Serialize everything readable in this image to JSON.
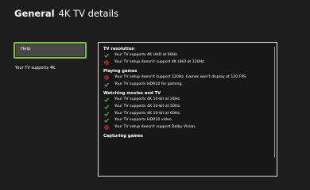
{
  "header": {
    "section": "General",
    "page": "4K TV details"
  },
  "sidebar": {
    "help_label": "Help",
    "tv_support_text": "Your TV supports 4K."
  },
  "colors": {
    "accent": "#7ec33a",
    "ok": "#5fc24a",
    "error": "#e0263b"
  },
  "details": {
    "sections": [
      {
        "title": "TV resolution",
        "rows": [
          {
            "status": "ok",
            "icon": "check-icon",
            "text": "Your TV supports 4K UHD at 60Hz."
          },
          {
            "status": "error",
            "icon": "prohibited-icon",
            "text": "Your TV setup doesn't support 4K UHD at 120Hz."
          }
        ]
      },
      {
        "title": "Playing games",
        "rows": [
          {
            "status": "error",
            "icon": "prohibited-icon",
            "text": "Your TV setup doesn't support 120Hz. Games won't display at 120 FPS."
          },
          {
            "status": "ok",
            "icon": "check-icon",
            "text": "Your TV supports HDR10 for gaming."
          }
        ]
      },
      {
        "title": "Watching movies and TV",
        "rows": [
          {
            "status": "ok",
            "icon": "check-icon",
            "text": "Your TV supports 4K 10-bit at 24Hz."
          },
          {
            "status": "ok",
            "icon": "check-icon",
            "text": "Your TV supports 4K 10-bit at 50Hz."
          },
          {
            "status": "ok",
            "icon": "check-icon",
            "text": "Your TV supports 4K 10-bit at 60Hz."
          },
          {
            "status": "ok",
            "icon": "check-icon",
            "text": "Your TV supports HDR10 video."
          },
          {
            "status": "error",
            "icon": "prohibited-icon",
            "text": "Your TV setup doesn't support Dolby Vision."
          }
        ]
      },
      {
        "title": "Capturing games",
        "rows": []
      }
    ]
  }
}
